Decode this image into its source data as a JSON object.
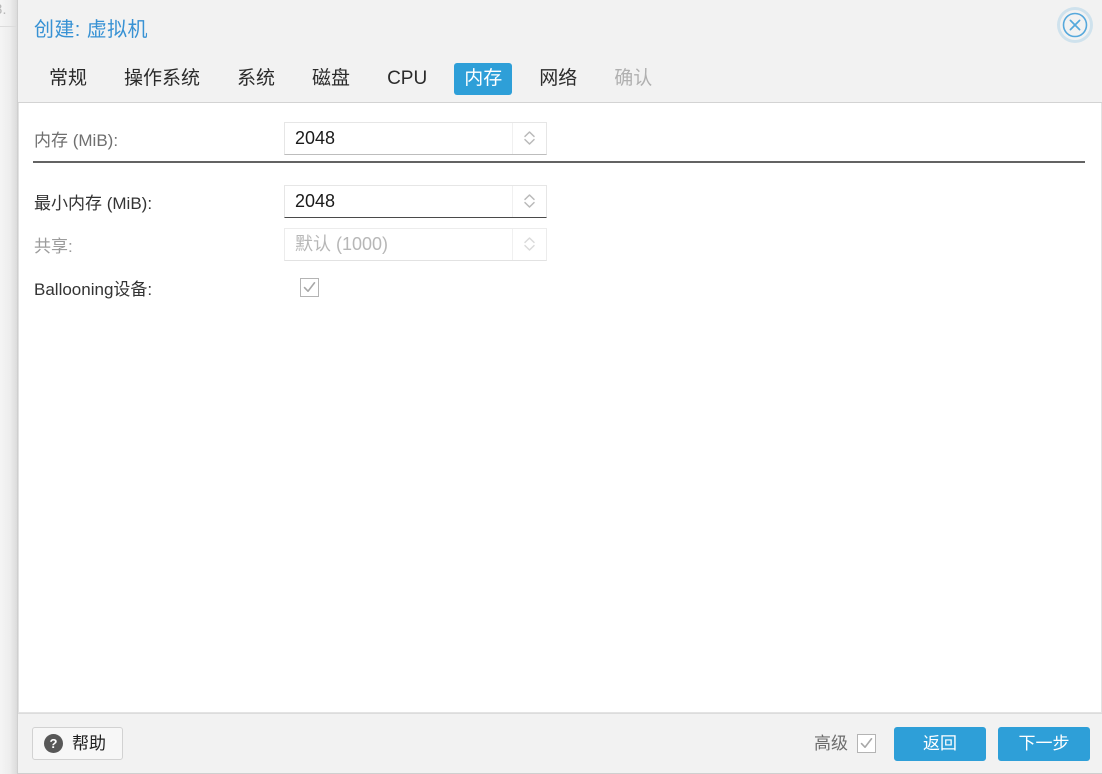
{
  "background": {
    "clipped_text": "8.",
    "icon": "background-strip"
  },
  "dialog": {
    "title": "创建: 虚拟机",
    "close_icon": "close-circle-icon",
    "tabs": [
      {
        "label": "常规",
        "state": "normal",
        "name": "tab-general"
      },
      {
        "label": "操作系统",
        "state": "normal",
        "name": "tab-os"
      },
      {
        "label": "系统",
        "state": "normal",
        "name": "tab-system"
      },
      {
        "label": "磁盘",
        "state": "normal",
        "name": "tab-disks"
      },
      {
        "label": "CPU",
        "state": "normal",
        "name": "tab-cpu"
      },
      {
        "label": "内存",
        "state": "active",
        "name": "tab-memory"
      },
      {
        "label": "网络",
        "state": "normal",
        "name": "tab-network"
      },
      {
        "label": "确认",
        "state": "disabled",
        "name": "tab-confirm"
      }
    ],
    "active_tab": "内存",
    "form": {
      "memory": {
        "label": "内存 (MiB):",
        "value": "2048",
        "placeholder": "",
        "disabled": false,
        "spinner_icon": "spinner-arrows-icon"
      },
      "min_memory": {
        "label": "最小内存 (MiB):",
        "value": "2048",
        "placeholder": "",
        "disabled": false,
        "spinner_icon": "spinner-arrows-icon"
      },
      "shares": {
        "label": "共享:",
        "value": "默认 (1000)",
        "placeholder": "默认 (1000)",
        "disabled": true,
        "spinner_icon": "spinner-arrows-icon"
      },
      "ballooning": {
        "label": "Ballooning设备:",
        "checked": true,
        "disabled": true,
        "check_icon": "checkmark-icon"
      }
    },
    "footer": {
      "help_label": "帮助",
      "help_icon": "question-mark-icon",
      "advanced_label": "高级",
      "advanced_checked": true,
      "advanced_check_icon": "checkmark-icon",
      "back_label": "返回",
      "next_label": "下一步"
    }
  },
  "colors": {
    "accent": "#2e9fd8",
    "title": "#3892d4",
    "header_bg": "#f2f2f2",
    "content_bg": "#ffffff",
    "divider": "#636363",
    "disabled_text": "#b0b0b0"
  }
}
